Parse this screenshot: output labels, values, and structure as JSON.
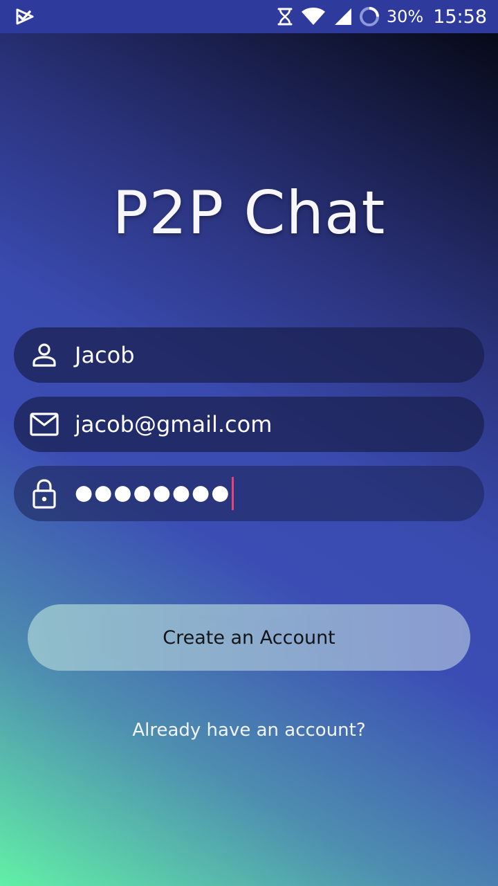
{
  "status_bar": {
    "app_icon": "play-check-icon",
    "icons": [
      "hourglass-icon",
      "wifi-icon",
      "cell-signal-icon",
      "battery-ring-icon"
    ],
    "battery": "30%",
    "time": "15:58",
    "background_color": "#2f3b9c"
  },
  "app": {
    "title": "P2P Chat"
  },
  "form": {
    "name": {
      "icon": "person-icon",
      "value": "Jacob"
    },
    "email": {
      "icon": "mail-icon",
      "value": "jacob@gmail.com"
    },
    "password": {
      "icon": "lock-icon",
      "value": "●●●●●●●●"
    }
  },
  "actions": {
    "create_account_label": "Create an Account",
    "login_link_label": "Already have an account?"
  },
  "colors": {
    "cursor": "#e8427a",
    "field_background": "#1a204e",
    "button_gradient_start": "#93c1cc",
    "button_gradient_end": "#8e9fd2"
  }
}
